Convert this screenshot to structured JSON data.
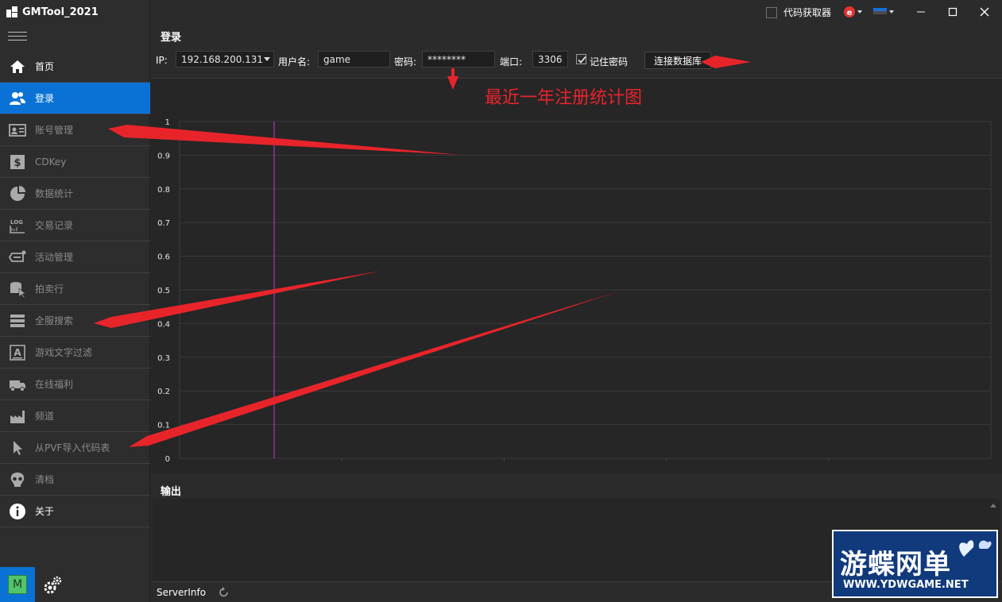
{
  "app": {
    "title": "GMTool_2021"
  },
  "titlebar": {
    "code_getter_label": "代码获取器"
  },
  "sidebar": {
    "items": [
      {
        "label": "首页",
        "icon": "home-icon",
        "enabled": true,
        "active": false
      },
      {
        "label": "登录",
        "icon": "users-icon",
        "enabled": true,
        "active": true
      },
      {
        "label": "账号管理",
        "icon": "id-card-icon",
        "enabled": false,
        "active": false
      },
      {
        "label": "CDKey",
        "icon": "dollar-icon",
        "enabled": false,
        "active": false
      },
      {
        "label": "数据统计",
        "icon": "pie-chart-icon",
        "enabled": false,
        "active": false
      },
      {
        "label": "交易记录",
        "icon": "log-icon",
        "enabled": false,
        "active": false
      },
      {
        "label": "活动管理",
        "icon": "ticket-icon",
        "enabled": false,
        "active": false
      },
      {
        "label": "拍卖行",
        "icon": "database-cursor-icon",
        "enabled": false,
        "active": false
      },
      {
        "label": "全服搜索",
        "icon": "server-icon",
        "enabled": false,
        "active": false
      },
      {
        "label": "游戏文字过滤",
        "icon": "text-filter-icon",
        "enabled": false,
        "active": false
      },
      {
        "label": "在线福利",
        "icon": "truck-icon",
        "enabled": false,
        "active": false
      },
      {
        "label": "频道",
        "icon": "factory-icon",
        "enabled": false,
        "active": false
      },
      {
        "label": "从PVF导入代码表",
        "icon": "cursor-icon",
        "enabled": false,
        "active": false
      },
      {
        "label": "清档",
        "icon": "skull-icon",
        "enabled": false,
        "active": false
      },
      {
        "label": "关于",
        "icon": "info-icon",
        "enabled": true,
        "active": false
      }
    ],
    "user_avatar_letter": "M"
  },
  "login": {
    "title": "登录",
    "ip_label": "IP:",
    "ip_value": "192.168.200.131",
    "username_label": "用户名:",
    "username_value": "game",
    "password_label": "密码:",
    "password_value": "********",
    "port_label": "端口:",
    "port_value": "3306",
    "remember_label": "记住密码",
    "remember_checked": true,
    "connect_label": "连接数据库"
  },
  "chart_data": {
    "type": "line",
    "title": "最近一年注册统计图",
    "xlabel": "",
    "ylabel": "",
    "ylim": [
      0,
      1
    ],
    "yticks": [
      "0",
      "0.1",
      "0.2",
      "0.3",
      "0.4",
      "0.5",
      "0.6",
      "0.7",
      "0.8",
      "0.9",
      "1"
    ],
    "x": [],
    "series": [],
    "grid": true,
    "marker_color": "#c23bd4"
  },
  "output": {
    "title": "输出"
  },
  "statusbar": {
    "server_info_label": "ServerInfo"
  },
  "watermark": {
    "main": "游蝶网单",
    "sub": "WWW.YDWGAME.NET"
  },
  "colors": {
    "accent": "#0a72d4",
    "annotation": "#e8242b",
    "background": "#2b2b2b"
  }
}
